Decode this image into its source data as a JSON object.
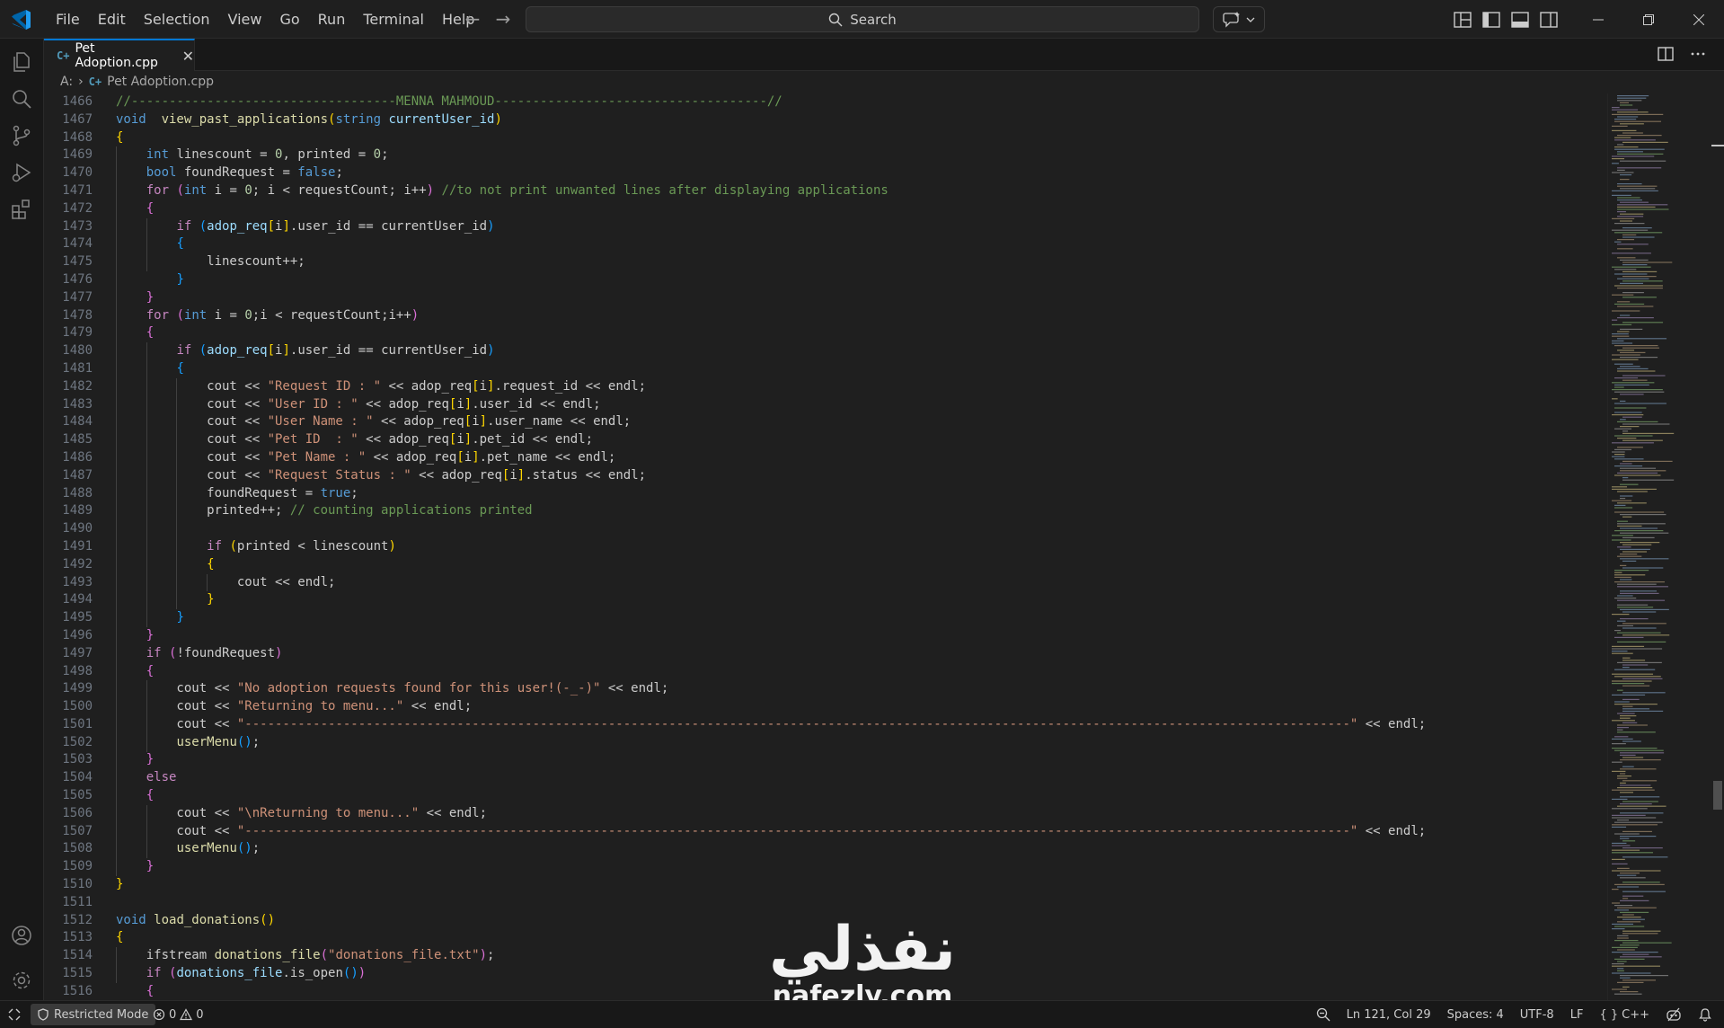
{
  "titlebar": {
    "menu": [
      "File",
      "Edit",
      "Selection",
      "View",
      "Go",
      "Run",
      "Terminal",
      "Help"
    ],
    "search_placeholder": "Search"
  },
  "tab": {
    "label": "Pet Adoption.cpp",
    "file_icon": "C++"
  },
  "breadcrumb": {
    "drive": "A:",
    "file": "Pet Adoption.cpp"
  },
  "status": {
    "restricted_mode": "Restricted Mode",
    "errors": "0",
    "warnings": "0",
    "cursor": "Ln 121, Col 29",
    "spaces": "Spaces: 4",
    "encoding": "UTF-8",
    "eol": "LF",
    "language": "C++"
  },
  "watermark": {
    "arabic": "نفذلي",
    "domain": "nafezly.com"
  },
  "colors": {
    "accent": "#0078d4",
    "background": "#1f1f1f",
    "sidebar": "#181818"
  },
  "editor": {
    "lines": [
      {
        "n": "1466",
        "t": [
          [
            "cm",
            "//-----------------------------------MENNA MAHMOUD------------------------------------//"
          ]
        ]
      },
      {
        "n": "1467",
        "t": [
          [
            "kw",
            "void"
          ],
          [
            "",
            "  "
          ],
          [
            "fn",
            "view_past_applications"
          ],
          [
            "b1",
            "("
          ],
          [
            "kw",
            "string"
          ],
          [
            "",
            " "
          ],
          [
            "var",
            "currentUser_id"
          ],
          [
            "b1",
            ")"
          ]
        ]
      },
      {
        "n": "1468",
        "t": [
          [
            "b1",
            "{"
          ]
        ]
      },
      {
        "n": "1469",
        "t": [
          [
            "",
            "    "
          ],
          [
            "kw",
            "int"
          ],
          [
            "",
            " linescount = "
          ],
          [
            "num",
            "0"
          ],
          [
            "",
            ", printed = "
          ],
          [
            "num",
            "0"
          ],
          [
            "",
            ";"
          ]
        ]
      },
      {
        "n": "1470",
        "t": [
          [
            "",
            "    "
          ],
          [
            "kw",
            "bool"
          ],
          [
            "",
            " foundRequest = "
          ],
          [
            "kw",
            "false"
          ],
          [
            "",
            ";"
          ]
        ]
      },
      {
        "n": "1471",
        "t": [
          [
            "",
            "    "
          ],
          [
            "kc",
            "for"
          ],
          [
            "",
            " "
          ],
          [
            "b2",
            "("
          ],
          [
            "kw",
            "int"
          ],
          [
            "",
            " i = "
          ],
          [
            "num",
            "0"
          ],
          [
            "",
            "; i < requestCount; i++"
          ],
          [
            "b2",
            ")"
          ],
          [
            "",
            " "
          ],
          [
            "cm",
            "//to not print unwanted lines after displaying applications"
          ]
        ]
      },
      {
        "n": "1472",
        "t": [
          [
            "",
            "    "
          ],
          [
            "b2",
            "{"
          ]
        ]
      },
      {
        "n": "1473",
        "t": [
          [
            "",
            "        "
          ],
          [
            "kc",
            "if"
          ],
          [
            "",
            " "
          ],
          [
            "b3",
            "("
          ],
          [
            "var",
            "adop_req"
          ],
          [
            "b1",
            "["
          ],
          [
            "",
            "i"
          ],
          [
            "b1",
            "]"
          ],
          [
            "",
            ".user_id == currentUser_id"
          ],
          [
            "b3",
            ")"
          ]
        ]
      },
      {
        "n": "1474",
        "t": [
          [
            "",
            "        "
          ],
          [
            "b3",
            "{"
          ]
        ]
      },
      {
        "n": "1475",
        "t": [
          [
            "",
            "            linescount++;"
          ]
        ]
      },
      {
        "n": "1476",
        "t": [
          [
            "",
            "        "
          ],
          [
            "b3",
            "}"
          ]
        ]
      },
      {
        "n": "1477",
        "t": [
          [
            "",
            "    "
          ],
          [
            "b2",
            "}"
          ]
        ]
      },
      {
        "n": "1478",
        "t": [
          [
            "",
            "    "
          ],
          [
            "kc",
            "for"
          ],
          [
            "",
            " "
          ],
          [
            "b2",
            "("
          ],
          [
            "kw",
            "int"
          ],
          [
            "",
            " i = "
          ],
          [
            "num",
            "0"
          ],
          [
            "",
            ";i < requestCount;i++"
          ],
          [
            "b2",
            ")"
          ]
        ]
      },
      {
        "n": "1479",
        "t": [
          [
            "",
            "    "
          ],
          [
            "b2",
            "{"
          ]
        ]
      },
      {
        "n": "1480",
        "t": [
          [
            "",
            "        "
          ],
          [
            "kc",
            "if"
          ],
          [
            "",
            " "
          ],
          [
            "b3",
            "("
          ],
          [
            "var",
            "adop_req"
          ],
          [
            "b1",
            "["
          ],
          [
            "",
            "i"
          ],
          [
            "b1",
            "]"
          ],
          [
            "",
            ".user_id == currentUser_id"
          ],
          [
            "b3",
            ")"
          ]
        ]
      },
      {
        "n": "1481",
        "t": [
          [
            "",
            "        "
          ],
          [
            "b3",
            "{"
          ]
        ]
      },
      {
        "n": "1482",
        "t": [
          [
            "",
            "            cout << "
          ],
          [
            "str",
            "\"Request ID : \""
          ],
          [
            "",
            " << adop_req"
          ],
          [
            "b1",
            "["
          ],
          [
            "",
            "i"
          ],
          [
            "b1",
            "]"
          ],
          [
            "",
            ".request_id << endl;"
          ]
        ]
      },
      {
        "n": "1483",
        "t": [
          [
            "",
            "            cout << "
          ],
          [
            "str",
            "\"User ID : \""
          ],
          [
            "",
            " << adop_req"
          ],
          [
            "b1",
            "["
          ],
          [
            "",
            "i"
          ],
          [
            "b1",
            "]"
          ],
          [
            "",
            ".user_id << endl;"
          ]
        ]
      },
      {
        "n": "1484",
        "t": [
          [
            "",
            "            cout << "
          ],
          [
            "str",
            "\"User Name : \""
          ],
          [
            "",
            " << adop_req"
          ],
          [
            "b1",
            "["
          ],
          [
            "",
            "i"
          ],
          [
            "b1",
            "]"
          ],
          [
            "",
            ".user_name << endl;"
          ]
        ]
      },
      {
        "n": "1485",
        "t": [
          [
            "",
            "            cout << "
          ],
          [
            "str",
            "\"Pet ID  : \""
          ],
          [
            "",
            " << adop_req"
          ],
          [
            "b1",
            "["
          ],
          [
            "",
            "i"
          ],
          [
            "b1",
            "]"
          ],
          [
            "",
            ".pet_id << endl;"
          ]
        ]
      },
      {
        "n": "1486",
        "t": [
          [
            "",
            "            cout << "
          ],
          [
            "str",
            "\"Pet Name : \""
          ],
          [
            "",
            " << adop_req"
          ],
          [
            "b1",
            "["
          ],
          [
            "",
            "i"
          ],
          [
            "b1",
            "]"
          ],
          [
            "",
            ".pet_name << endl;"
          ]
        ]
      },
      {
        "n": "1487",
        "t": [
          [
            "",
            "            cout << "
          ],
          [
            "str",
            "\"Request Status : \""
          ],
          [
            "",
            " << adop_req"
          ],
          [
            "b1",
            "["
          ],
          [
            "",
            "i"
          ],
          [
            "b1",
            "]"
          ],
          [
            "",
            ".status << endl;"
          ]
        ]
      },
      {
        "n": "1488",
        "t": [
          [
            "",
            "            foundRequest = "
          ],
          [
            "kw",
            "true"
          ],
          [
            "",
            ";"
          ]
        ]
      },
      {
        "n": "1489",
        "t": [
          [
            "",
            "            printed++; "
          ],
          [
            "cm",
            "// counting applications printed"
          ]
        ]
      },
      {
        "n": "1490",
        "t": []
      },
      {
        "n": "1491",
        "t": [
          [
            "",
            "            "
          ],
          [
            "kc",
            "if"
          ],
          [
            "",
            " "
          ],
          [
            "b1",
            "("
          ],
          [
            "",
            "printed < linescount"
          ],
          [
            "b1",
            ")"
          ]
        ]
      },
      {
        "n": "1492",
        "t": [
          [
            "",
            "            "
          ],
          [
            "b1",
            "{"
          ]
        ]
      },
      {
        "n": "1493",
        "t": [
          [
            "",
            "                cout << endl;"
          ]
        ]
      },
      {
        "n": "1494",
        "t": [
          [
            "",
            "            "
          ],
          [
            "b1",
            "}"
          ]
        ]
      },
      {
        "n": "1495",
        "t": [
          [
            "",
            "        "
          ],
          [
            "b3",
            "}"
          ]
        ]
      },
      {
        "n": "1496",
        "t": [
          [
            "",
            "    "
          ],
          [
            "b2",
            "}"
          ]
        ]
      },
      {
        "n": "1497",
        "t": [
          [
            "",
            "    "
          ],
          [
            "kc",
            "if"
          ],
          [
            "",
            " "
          ],
          [
            "b2",
            "("
          ],
          [
            "",
            "!foundRequest"
          ],
          [
            "b2",
            ")"
          ]
        ]
      },
      {
        "n": "1498",
        "t": [
          [
            "",
            "    "
          ],
          [
            "b2",
            "{"
          ]
        ]
      },
      {
        "n": "1499",
        "t": [
          [
            "",
            "        cout << "
          ],
          [
            "str",
            "\"No adoption requests found for this user!(-_-)\""
          ],
          [
            "",
            " << endl;"
          ]
        ]
      },
      {
        "n": "1500",
        "t": [
          [
            "",
            "        cout << "
          ],
          [
            "str",
            "\"Returning to menu...\""
          ],
          [
            "",
            " << endl;"
          ]
        ]
      },
      {
        "n": "1501",
        "t": [
          [
            "",
            "        cout << "
          ],
          [
            "str",
            "\"--------------------------------------------------------------------------------------------------------------------------------------------------\""
          ],
          [
            "",
            " << endl;"
          ]
        ]
      },
      {
        "n": "1502",
        "t": [
          [
            "",
            "        "
          ],
          [
            "fn",
            "userMenu"
          ],
          [
            "b3",
            "()"
          ],
          [
            "",
            ";"
          ]
        ]
      },
      {
        "n": "1503",
        "t": [
          [
            "",
            "    "
          ],
          [
            "b2",
            "}"
          ]
        ]
      },
      {
        "n": "1504",
        "t": [
          [
            "",
            "    "
          ],
          [
            "kc",
            "else"
          ]
        ]
      },
      {
        "n": "1505",
        "t": [
          [
            "",
            "    "
          ],
          [
            "b2",
            "{"
          ]
        ]
      },
      {
        "n": "1506",
        "t": [
          [
            "",
            "        cout << "
          ],
          [
            "str",
            "\"\\nReturning to menu...\""
          ],
          [
            "",
            " << endl;"
          ]
        ]
      },
      {
        "n": "1507",
        "t": [
          [
            "",
            "        cout << "
          ],
          [
            "str",
            "\"--------------------------------------------------------------------------------------------------------------------------------------------------\""
          ],
          [
            "",
            " << endl;"
          ]
        ]
      },
      {
        "n": "1508",
        "t": [
          [
            "",
            "        "
          ],
          [
            "fn",
            "userMenu"
          ],
          [
            "b3",
            "()"
          ],
          [
            "",
            ";"
          ]
        ]
      },
      {
        "n": "1509",
        "t": [
          [
            "",
            "    "
          ],
          [
            "b2",
            "}"
          ]
        ]
      },
      {
        "n": "1510",
        "t": [
          [
            "b1",
            "}"
          ]
        ]
      },
      {
        "n": "1511",
        "t": []
      },
      {
        "n": "1512",
        "t": [
          [
            "kw",
            "void"
          ],
          [
            "",
            " "
          ],
          [
            "fn",
            "load_donations"
          ],
          [
            "b1",
            "()"
          ]
        ]
      },
      {
        "n": "1513",
        "t": [
          [
            "b1",
            "{"
          ]
        ]
      },
      {
        "n": "1514",
        "t": [
          [
            "",
            "    ifstream "
          ],
          [
            "fn",
            "donations_file"
          ],
          [
            "b2",
            "("
          ],
          [
            "str",
            "\"donations_file.txt\""
          ],
          [
            "b2",
            ")"
          ],
          [
            "",
            ";"
          ]
        ]
      },
      {
        "n": "1515",
        "t": [
          [
            "",
            "    "
          ],
          [
            "kc",
            "if"
          ],
          [
            "",
            " "
          ],
          [
            "b2",
            "("
          ],
          [
            "var",
            "donations_file"
          ],
          [
            "",
            ".is_open"
          ],
          [
            "b3",
            "()"
          ],
          [
            "b2",
            ")"
          ]
        ]
      },
      {
        "n": "1516",
        "t": [
          [
            "",
            "    "
          ],
          [
            "b2",
            "{"
          ]
        ]
      }
    ]
  }
}
